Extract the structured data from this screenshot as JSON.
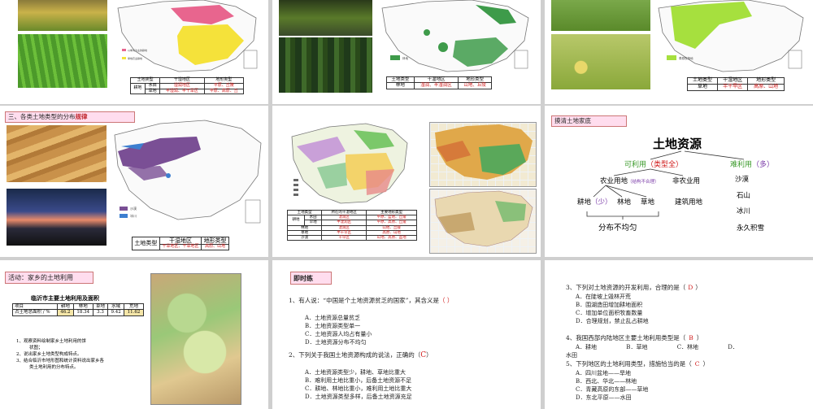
{
  "s1": {
    "legend": [
      "以季风为主的耕地",
      "旱地农业耕地"
    ],
    "table": {
      "h": [
        "土地类型",
        "干湿地区",
        "地形类型"
      ],
      "row_type": "耕地",
      "rows": [
        {
          "sub": "水田",
          "region": "湿润地区",
          "terrain": "平原、丘陵"
        },
        {
          "sub": "旱地",
          "region": "半湿润、半干旱区",
          "terrain": "平原、高原、丘"
        }
      ]
    }
  },
  "s2": {
    "legend": "林地",
    "table": {
      "h": [
        "土地类型",
        "干湿地区",
        "地形类型"
      ],
      "type": "林地",
      "region": "湿润、半湿润区",
      "terrain": "山地、丘陵"
    }
  },
  "s3": {
    "legend": "草原牧场地",
    "table": {
      "h": [
        "土地类型",
        "干湿地区",
        "地形类型"
      ],
      "type": "草地",
      "region": "半干旱区",
      "terrain": "高原、山地"
    }
  },
  "s4": {
    "header": "三、各类土地类型的分布",
    "header_em": "规律",
    "legend": [
      "沙漠",
      "冰川"
    ],
    "table": {
      "h": [
        "土地类型",
        "干湿地区",
        "地形类型"
      ],
      "region": "干旱",
      "region2": "干旱地区、干旱地区",
      "terrain": "高原、山地"
    }
  },
  "s5": {
    "table": {
      "h": [
        "土地类型",
        "所在的干湿地区",
        "主要地形类型"
      ],
      "rows": [
        {
          "type": "耕地",
          "sub": "水田",
          "region": "湿润区",
          "terrain": "平原、盆地、丘陵"
        },
        {
          "type": "",
          "sub": "旱地",
          "region": "半湿润区",
          "terrain": "平原、高原、丘陵"
        },
        {
          "type": "林地",
          "sub": "",
          "region": "湿润区",
          "terrain": "山地、丘陵"
        },
        {
          "type": "草地",
          "sub": "",
          "region": "半干旱区",
          "terrain": "高原、山地"
        },
        {
          "type": "沙漠",
          "sub": "",
          "region": "干旱区",
          "terrain": "山地、高原、盆地"
        }
      ]
    }
  },
  "s6": {
    "header": "摸清土地家底",
    "title": "土地资源",
    "usable": "可利用",
    "usable_note": "（类型全）",
    "hard": "难利用",
    "hard_note": "（多）",
    "ag": "农业用地",
    "ag_note": "（结构不合理）",
    "nonag": "非农业用",
    "farm": "耕地",
    "farm_note": "（少）",
    "forest": "林地",
    "grass": "草地",
    "build": "建筑用地",
    "desert": "沙漠",
    "rock": "石山",
    "glacier": "冰川",
    "snow": "永久积雪",
    "uneven": "分布不均匀"
  },
  "s7": {
    "header": "活动：家乡的土地利用",
    "table_title": "临沂市主要土地利用及面积",
    "cols": [
      "项目",
      "耕地",
      "林地",
      "草地",
      "水域",
      "荒地"
    ],
    "row_label": "占土地总面积 / %",
    "values": [
      "46.2",
      "18.34",
      "3.3",
      "9.42",
      "11.62"
    ],
    "notes": [
      "1、观察资料绘制家乡土地利用的饼",
      "状图；",
      "2、说出家乡土地类型构成特点。",
      "3、结合临沂市地形图和统计资料说出家乡各",
      "类土地利用的分布特点。"
    ]
  },
  "s8": {
    "header": "即时练",
    "q1": "1、有人说：“中国是个土地资源贫乏的国家”，其含义是",
    "q1_ans": "（ ）",
    "q1_opts": [
      "A．土地资源总量贫乏",
      "B．土地资源类型单一",
      "C．土地资源人均占有量小",
      "D．土地资源分布不均匀"
    ],
    "q2": "2、下列关于我国土地资源构成的说法，正确的（",
    "q2_ans": "C",
    "q2_end": "）",
    "q2_opts": [
      "A．土地资源类型少，耕地、草地比重大",
      "B．难利用土地比重小，后备土地资源不足",
      "C．耕地、林地比重小，难利用土地比重大",
      "D．土地资源类型多样，后备土地资源充足"
    ]
  },
  "s9": {
    "q3": "3、下列对土地资源的开发利用，合理的是（",
    "q3_ans": "D",
    "q3_opts": [
      "A．在陡坡上毁林开荒",
      "B．围湖造田增加耕地面积",
      "C．增加单位面积牧畜数量",
      "D．合理规划，禁止乱占耕地"
    ],
    "q4": "4、我国西部内陆地区主要土地利用类型是（",
    "q4_ans": "B",
    "q4_opts": [
      "A．耕地",
      "B．草地",
      "C．林地",
      "D．"
    ],
    "q4_tail": "水田",
    "q5": "5、下列地区的土地利用类型，措施恰当的是（",
    "q5_ans": "C",
    "q5_opts": [
      "A．四川盆地——旱地",
      "B．西北、华北——林地",
      "C．青藏高原的东部——草地",
      "D．东北平原——水田"
    ]
  },
  "colors": {
    "header_red": "#c0282e",
    "answer_red": "#d01818",
    "farm_pink": "#e8658e",
    "farm_yellow": "#f5e23a",
    "forest_green": "#3e9b4a",
    "grass_green": "#a6e03e",
    "desert_purple": "#7a4f95",
    "glacier_blue": "#3d7fd0"
  }
}
